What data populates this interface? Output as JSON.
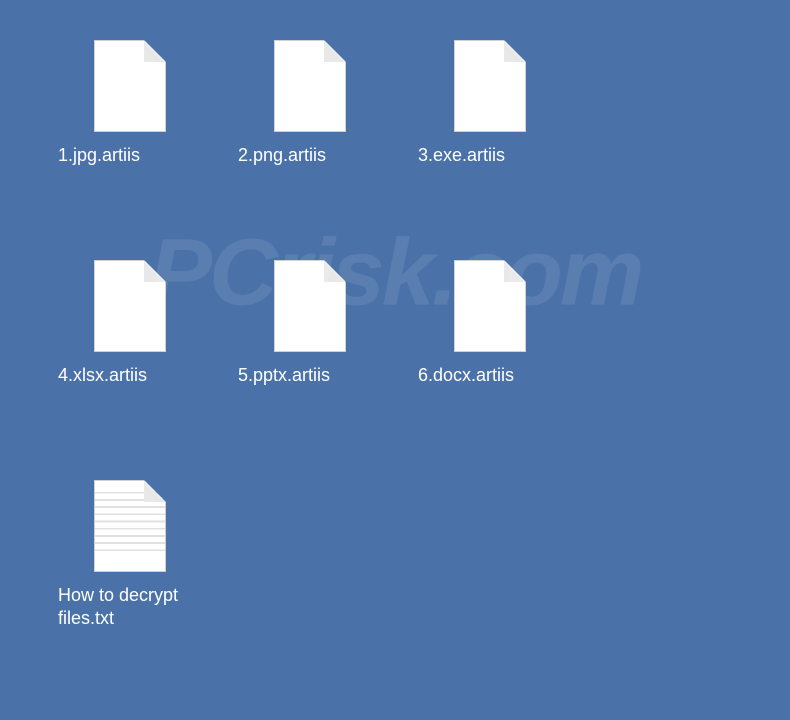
{
  "watermark": "PCrisk.com",
  "files": [
    {
      "name": "1.jpg.artiis",
      "type": "generic"
    },
    {
      "name": "2.png.artiis",
      "type": "generic"
    },
    {
      "name": "3.exe.artiis",
      "type": "generic"
    },
    {
      "name": "4.xlsx.artiis",
      "type": "generic"
    },
    {
      "name": "5.pptx.artiis",
      "type": "generic"
    },
    {
      "name": "6.docx.artiis",
      "type": "generic"
    },
    {
      "name": "How to decrypt files.txt",
      "type": "text"
    }
  ]
}
